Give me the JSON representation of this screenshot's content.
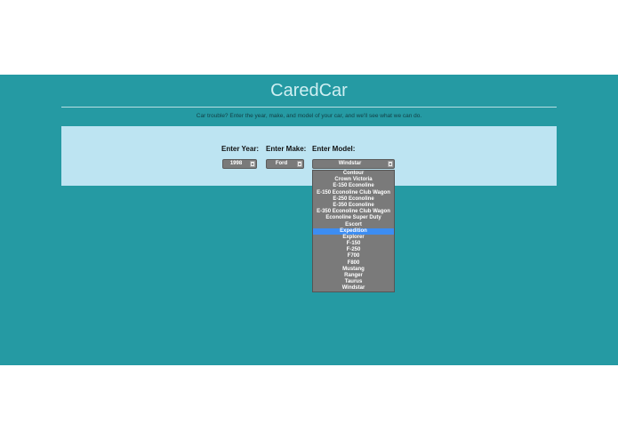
{
  "app": {
    "title": "CaredCar",
    "subtitle": "Car trouble? Enter the year, make, and model of your car, and we'll see what we can do."
  },
  "form": {
    "year": {
      "label": "Enter Year:",
      "value": "1998"
    },
    "make": {
      "label": "Enter Make:",
      "value": "Ford"
    },
    "model": {
      "label": "Enter Model:",
      "value": "Windstar",
      "highlighted": "Expedition",
      "options": [
        "Contour",
        "Crown Victoria",
        "E-150 Econoline",
        "E-150 Econoline Club Wagon",
        "E-250 Econoline",
        "E-350 Econoline",
        "E-350 Econoline Club Wagon",
        "Econoline Super Duty",
        "Escort",
        "Expedition",
        "Explorer",
        "F-150",
        "F-250",
        "F700",
        "F800",
        "Mustang",
        "Ranger",
        "Taurus",
        "Windstar"
      ]
    }
  },
  "colors": {
    "band": "#259aa3",
    "panel": "#bde4f2",
    "select": "#7a7a7a",
    "highlight": "#3d8df2"
  }
}
